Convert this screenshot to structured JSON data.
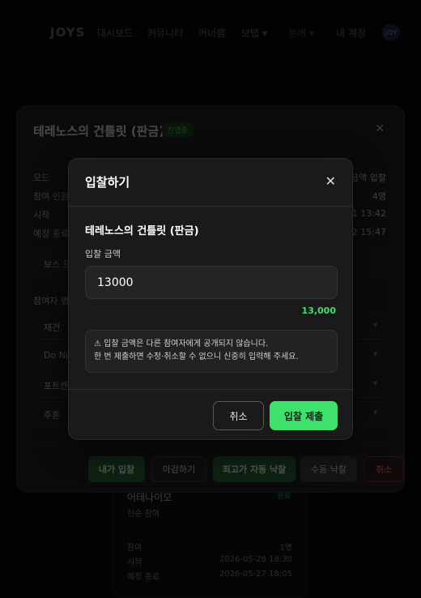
{
  "nav": {
    "logo": "JOYS",
    "items": [
      "대시보드",
      "커뮤니티",
      "어너램",
      "보탭",
      "분배",
      "내 계정"
    ],
    "avatar": "JOY"
  },
  "detail": {
    "title": "테레노스의 건틀릿 (판금)",
    "status": "진행중",
    "info": [
      {
        "label": "모드",
        "value": "금액 입찰"
      },
      {
        "label": "참여 인원",
        "value": "4명"
      },
      {
        "label": "시작",
        "value": "3-11 13:42"
      },
      {
        "label": "예정 종료",
        "value": "3-12 15:47"
      }
    ],
    "boss_label": "보스 드",
    "participants_title": "참여자 명",
    "participants": [
      "재건",
      "Do Not",
      "포트캔",
      "주혼"
    ],
    "actions": {
      "my_bid": "내가 입찰",
      "close_bid": "마감하기",
      "auto_award": "최고가 자동 낙찰",
      "manual_award": "수동 낙찰",
      "cancel": "취소"
    }
  },
  "bg_card": {
    "title": "어테나이모",
    "badge": "완료",
    "subtitle": "신순 참여",
    "rows": [
      {
        "k": "참여",
        "v": "1명"
      },
      {
        "k": "시작",
        "v": "2026-05-28 18:30"
      },
      {
        "k": "예정 종료",
        "v": "2026-05-27 18:05"
      }
    ]
  },
  "modal": {
    "title": "입찰하기",
    "item_name": "테레노스의 건틀릿 (판금)",
    "field_label": "입찰 금액",
    "amount_value": "13000",
    "amount_formatted": "13,000",
    "notice_line1": "⚠ 입찰 금액은 다른 참여자에게 공개되지 않습니다.",
    "notice_line2": "한 번 제출하면 수정·취소할 수 없으니 신중히 입력해 주세요.",
    "cancel_label": "취소",
    "submit_label": "입찰 제출"
  },
  "colors": {
    "accent": "#3ee06e",
    "danger": "#ff6b6b",
    "modal_bg": "#1a1a1a"
  }
}
